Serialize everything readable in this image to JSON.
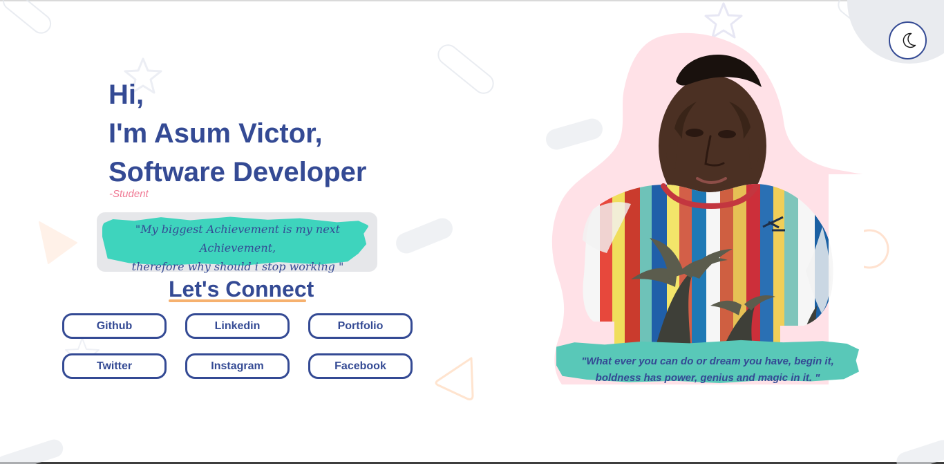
{
  "hero": {
    "line1": "Hi,",
    "line2": "I'm Asum Victor,",
    "line3": "Software Developer",
    "role": "-Student"
  },
  "quotes": {
    "left_quote_line1": "\"My biggest Achievement is my next Achievement,",
    "left_quote_line2": "therefore why should i stop working \"",
    "right_quote_line1": "\"What ever you can do or dream you have, begin it,",
    "right_quote_line2": "boldness has power, genius and magic in it. \""
  },
  "connect": {
    "title": "Let's Connect",
    "buttons": [
      {
        "label": "Github"
      },
      {
        "label": "Linkedin"
      },
      {
        "label": "Portfolio"
      },
      {
        "label": "Twitter"
      },
      {
        "label": "Instagram"
      },
      {
        "label": "Facebook"
      }
    ]
  },
  "colors": {
    "primary": "#344a94",
    "accent_pink": "#f07a95",
    "accent_teal": "#3ed4bd",
    "accent_orange": "#f6b16f",
    "blob_pink": "#ffe1e7"
  },
  "icons": {
    "theme_toggle": "moon-icon",
    "portrait": "profile-photo",
    "background_star": "star-outline-icon",
    "background_triangle": "triangle-outline-icon",
    "background_ring": "ring-outline-icon"
  }
}
